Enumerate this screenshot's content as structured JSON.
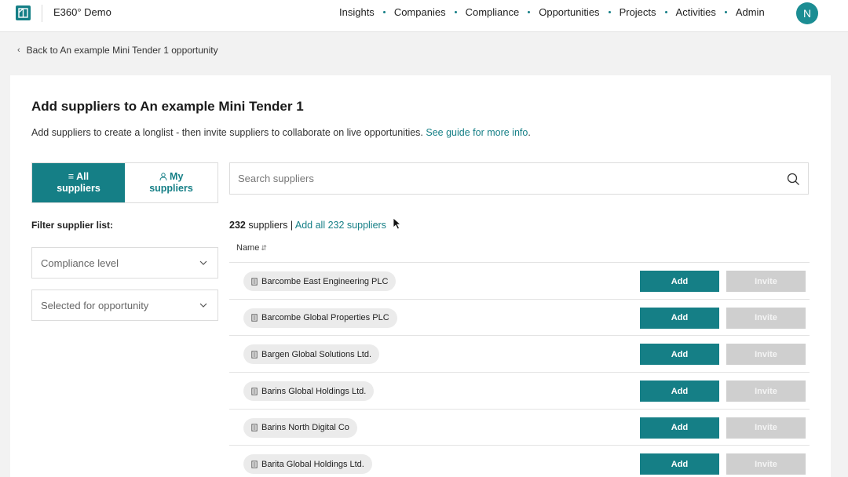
{
  "nav": {
    "app_title": "E360° Demo",
    "items": [
      "Insights",
      "Companies",
      "Compliance",
      "Opportunities",
      "Projects",
      "Activities",
      "Admin"
    ],
    "avatar_initial": "N"
  },
  "back_link": "Back to An example Mini Tender 1 opportunity",
  "page": {
    "title": "Add suppliers to An example Mini Tender 1",
    "subtitle": "Add suppliers to create a longlist - then invite suppliers to collaborate on live opportunities.",
    "guide_link": "See guide for more info",
    "guide_suffix": "."
  },
  "toggle": {
    "all_line1": "All",
    "all_line2": "suppliers",
    "my_line1": "My",
    "my_line2": "suppliers"
  },
  "filters": {
    "label": "Filter supplier list:",
    "compliance": "Compliance level",
    "selected": "Selected for opportunity"
  },
  "search": {
    "placeholder": "Search suppliers"
  },
  "results": {
    "count": "232",
    "count_suffix": "suppliers |",
    "add_all": "Add all 232 suppliers"
  },
  "table": {
    "name_header": "Name",
    "add_label": "Add",
    "invite_label": "Invite",
    "rows": [
      "Barcombe East Engineering PLC",
      "Barcombe Global Properties PLC",
      "Bargen Global Solutions Ltd.",
      "Barins Global Holdings Ltd.",
      "Barins North Digital Co",
      "Barita Global Holdings Ltd."
    ]
  },
  "colors": {
    "accent": "#157f86",
    "disabled": "#cfcfcf"
  }
}
